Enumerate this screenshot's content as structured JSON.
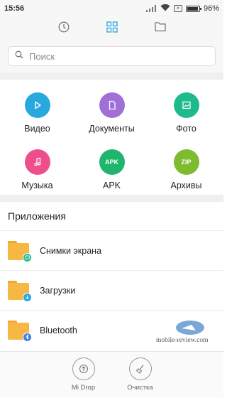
{
  "status_bar": {
    "time": "15:56",
    "battery": "96%",
    "battery_level": 0.96,
    "icons": [
      "signal-icon",
      "wifi-icon",
      "sim-off-icon",
      "battery-icon"
    ]
  },
  "tabs": [
    {
      "name": "recent",
      "icon": "clock-icon",
      "active": false
    },
    {
      "name": "categories",
      "icon": "grid-icon",
      "active": true
    },
    {
      "name": "files",
      "icon": "folder-icon",
      "active": false
    }
  ],
  "search": {
    "placeholder": "Поиск"
  },
  "categories": [
    {
      "label": "Видео",
      "icon": "play-icon",
      "color": "#29a8e0",
      "glyph": ""
    },
    {
      "label": "Документы",
      "icon": "document-icon",
      "color": "#a06fd8",
      "glyph": ""
    },
    {
      "label": "Фото",
      "icon": "image-icon",
      "color": "#1fb98e",
      "glyph": ""
    },
    {
      "label": "Музыка",
      "icon": "music-note-icon",
      "color": "#ef4e8c",
      "glyph": ""
    },
    {
      "label": "APK",
      "icon": "apk-icon",
      "color": "#20b56e",
      "glyph": "APK"
    },
    {
      "label": "Архивы",
      "icon": "zip-icon",
      "color": "#7dbb2f",
      "glyph": "ZIP"
    }
  ],
  "apps_section": {
    "title": "Приложения",
    "items": [
      {
        "name": "Снимки экрана",
        "badge_icon": "screenshot-icon",
        "badge_color": "#1fb98e"
      },
      {
        "name": "Загрузки",
        "badge_icon": "download-icon",
        "badge_color": "#29a8e0"
      },
      {
        "name": "Bluetooth",
        "badge_icon": "bluetooth-icon",
        "badge_color": "#3f7de0"
      }
    ]
  },
  "bottom_bar": {
    "mi_drop": "Mi Drop",
    "cleanup": "Очистка"
  },
  "watermark": {
    "text": "mobile-review.com"
  },
  "colors": {
    "accent": "#2aa6e0",
    "folder": "#f7b843"
  }
}
